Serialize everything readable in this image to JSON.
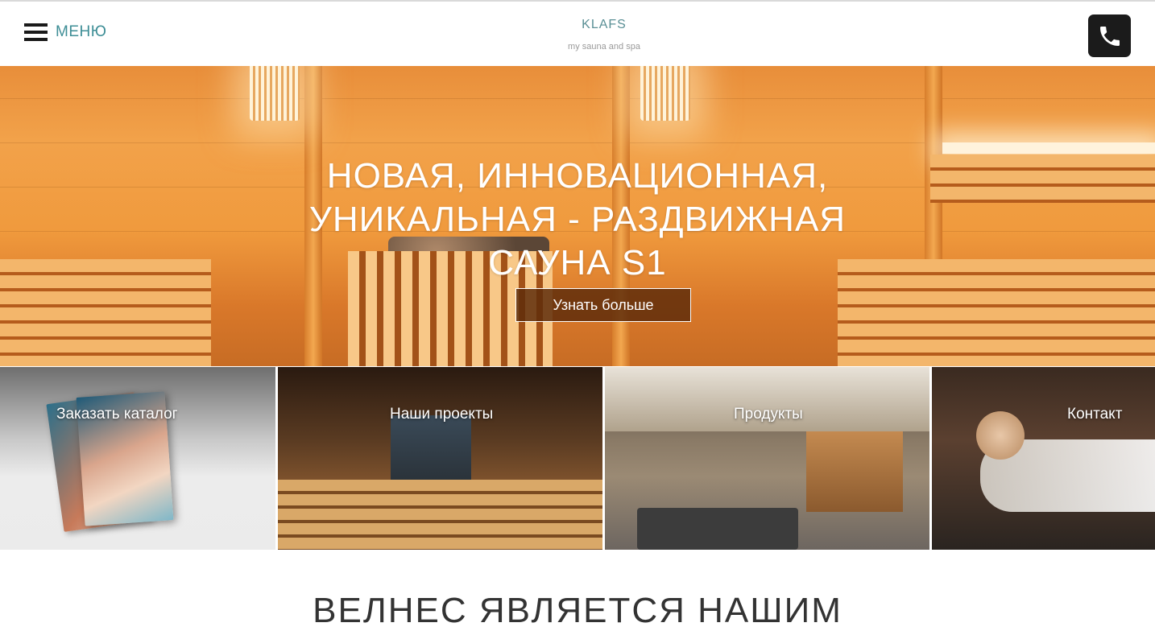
{
  "header": {
    "menu_label": "МЕНЮ",
    "brand_name": "KLAFS",
    "brand_tagline": "my sauna and spa",
    "phone_icon": "phone-icon",
    "menu_icon": "hamburger-icon"
  },
  "hero": {
    "title_line1": "НОВАЯ, ИННОВАЦИОННАЯ,",
    "title_line2": "УНИКАЛЬНАЯ - РАЗДВИЖНАЯ",
    "title_line3": "САУНА S1",
    "button_label": "Узнать больше"
  },
  "tiles": [
    {
      "label": "Заказать каталог"
    },
    {
      "label": "Наши проекты"
    },
    {
      "label": "Продукты"
    },
    {
      "label": "Контакт"
    }
  ],
  "section": {
    "title": "ВЕЛНЕС ЯВЛЯЕТСЯ НАШИМ"
  },
  "colors": {
    "accent": "#3e8e96",
    "phone_bg": "#1b1b1b",
    "hero_button_bg": "#5f2d0a"
  }
}
